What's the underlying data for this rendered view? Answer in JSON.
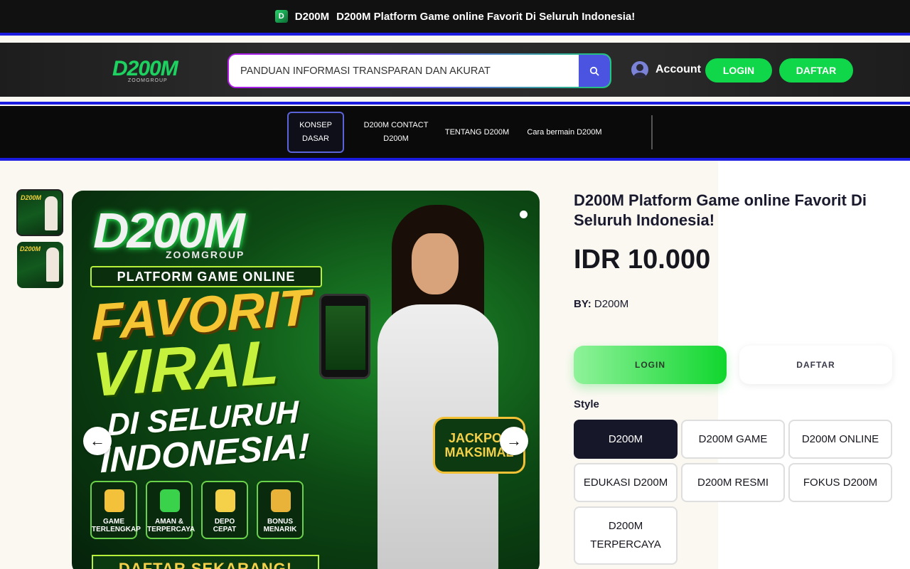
{
  "topbar": {
    "brand": "D200M",
    "text": "D200M Platform Game online Favorit Di Seluruh Indonesia!"
  },
  "header": {
    "logo_text": "D200M",
    "logo_sub": "ZOOMGROUP",
    "search_placeholder": "PANDUAN INFORMASI TRANSPARAN DAN AKURAT",
    "account_label": "Account",
    "login_label": "LOGIN",
    "daftar_label": "DAFTAR"
  },
  "nav": {
    "items": [
      {
        "label": "KONSEP DASAR"
      },
      {
        "label": "D200M CONTACT D200M"
      },
      {
        "label": "TENTANG D200M"
      },
      {
        "label": "Cara bermain D200M"
      }
    ]
  },
  "gallery": {
    "thumb_text": "D200M",
    "banner": {
      "logo": "D200M",
      "group": "ZOOMGROUP",
      "platform": "PLATFORM GAME ONLINE",
      "line1": "FAVORIT",
      "line2": "VIRAL",
      "line3": "DI SELURUH",
      "line4": "INDONESIA!",
      "jackpot": "JACKPOT MAKSIMAL",
      "features": [
        "GAME TERLENGKAP",
        "AMAN & TERPERCAYA",
        "DEPO CEPAT",
        "BONUS MENARIK"
      ],
      "cta": "DAFTAR SEKARANG!"
    }
  },
  "product": {
    "title": "D200M Platform Game online Favorit Di Seluruh Indonesia!",
    "price": "IDR 10.000",
    "by_label": "BY:",
    "by_value": "D200M",
    "login_label": "LOGIN",
    "daftar_label": "DAFTAR",
    "style_label": "Style",
    "styles": [
      "D200M",
      "D200M GAME",
      "D200M ONLINE",
      "EDUKASI D200M",
      "D200M RESMI",
      "FOKUS D200M",
      "D200M TERPERCAYA"
    ]
  },
  "colors": {
    "accent_green": "#10d64a",
    "search_button": "#4a54e1",
    "nav_border": "#5b63d8",
    "stripe_blue": "#1c1ce0"
  }
}
